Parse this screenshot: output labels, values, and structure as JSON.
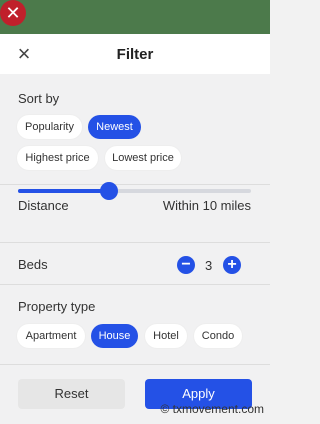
{
  "header": {
    "title": "Filter"
  },
  "sort": {
    "label": "Sort by",
    "options": [
      "Popularity",
      "Newest",
      "Highest price",
      "Lowest price"
    ],
    "selected": "Newest"
  },
  "distance": {
    "label": "Distance",
    "value_text": "Within 10 miles",
    "level_fraction": 0.39
  },
  "beds": {
    "label": "Beds",
    "count": "3",
    "minus": "−",
    "plus": "+"
  },
  "property": {
    "label": "Property type",
    "options": [
      "Apartment",
      "House",
      "Hotel",
      "Condo"
    ],
    "selected": "House"
  },
  "actions": {
    "reset": "Reset",
    "apply": "Apply"
  },
  "colors": {
    "accent": "#2451e6",
    "topbar": "#4c7a4b",
    "close_badge": "#c0202b"
  },
  "icons": {
    "close_badge": "close-icon",
    "header_close": "close-icon"
  },
  "watermark": "© txmovement.com"
}
